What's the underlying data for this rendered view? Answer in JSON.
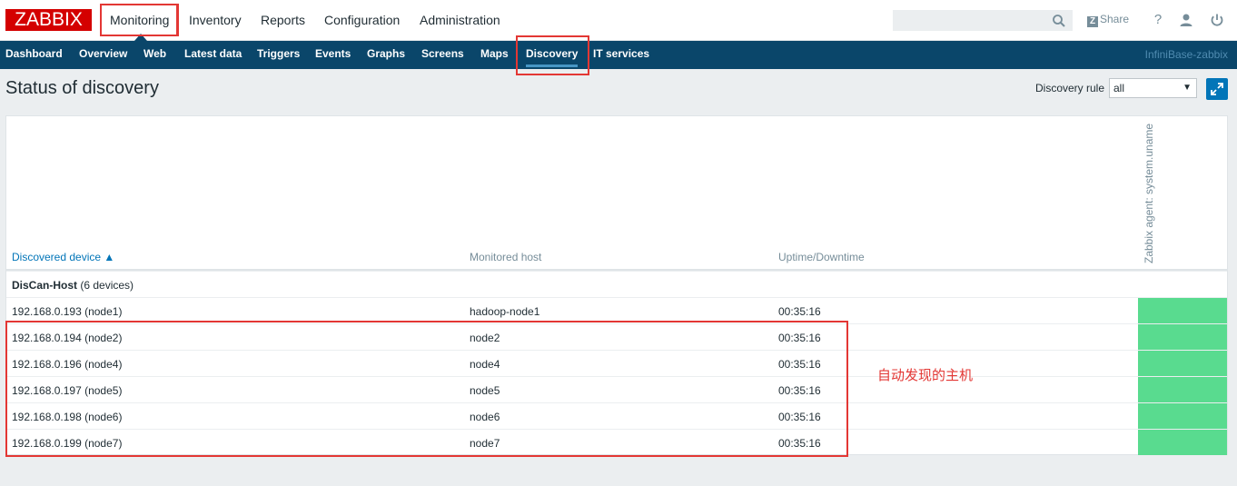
{
  "app": {
    "logo": "ZABBIX"
  },
  "main_menu": [
    {
      "label": "Monitoring"
    },
    {
      "label": "Inventory"
    },
    {
      "label": "Reports"
    },
    {
      "label": "Configuration"
    },
    {
      "label": "Administration"
    }
  ],
  "topbar": {
    "share_label": "Share",
    "share_badge": "Z",
    "help_label": "?"
  },
  "sub_menu": [
    {
      "label": "Dashboard"
    },
    {
      "label": "Overview"
    },
    {
      "label": "Web"
    },
    {
      "label": "Latest data"
    },
    {
      "label": "Triggers"
    },
    {
      "label": "Events"
    },
    {
      "label": "Graphs"
    },
    {
      "label": "Screens"
    },
    {
      "label": "Maps"
    },
    {
      "label": "Discovery"
    },
    {
      "label": "IT services"
    }
  ],
  "server_name": "InfiniBase-zabbix",
  "page": {
    "title": "Status of discovery",
    "filter_label": "Discovery rule",
    "filter_value": "all",
    "select_arrow": "▼"
  },
  "table": {
    "headers": {
      "device": "Discovered device ▲",
      "host": "Monitored host",
      "uptime": "Uptime/Downtime",
      "check": "Zabbix agent: system.uname"
    },
    "group": {
      "name": "DisCan-Host",
      "count": "(6 devices)"
    },
    "rows": [
      {
        "device": "192.168.0.193 (node1)",
        "host": "hadoop-node1",
        "uptime": "00:35:16"
      },
      {
        "device": "192.168.0.194 (node2)",
        "host": "node2",
        "uptime": "00:35:16"
      },
      {
        "device": "192.168.0.196 (node4)",
        "host": "node4",
        "uptime": "00:35:16"
      },
      {
        "device": "192.168.0.197 (node5)",
        "host": "node5",
        "uptime": "00:35:16"
      },
      {
        "device": "192.168.0.198 (node6)",
        "host": "node6",
        "uptime": "00:35:16"
      },
      {
        "device": "192.168.0.199 (node7)",
        "host": "node7",
        "uptime": "00:35:16"
      }
    ]
  },
  "annotation": "自动发现的主机",
  "colors": {
    "status_up": "#59db8f",
    "highlight": "#e33734",
    "nav": "#0a466a",
    "brand": "#d40000"
  }
}
